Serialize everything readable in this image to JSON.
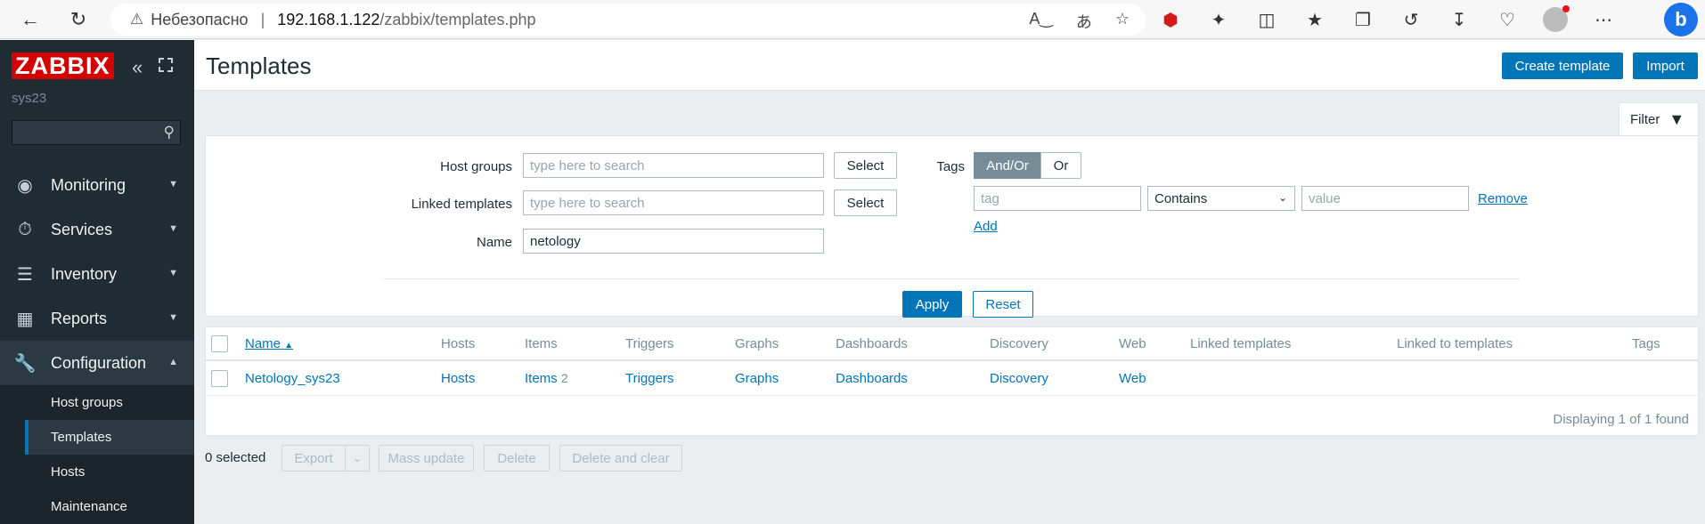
{
  "browser": {
    "insecure_label": "Небезопасно",
    "url_host": "192.168.1.122",
    "url_path": "/zabbix/templates.php"
  },
  "sidebar": {
    "logo": "ZABBIX",
    "server_name": "sys23",
    "menu": [
      {
        "label": "Monitoring",
        "icon": "eye-icon"
      },
      {
        "label": "Services",
        "icon": "stopwatch-icon"
      },
      {
        "label": "Inventory",
        "icon": "list-icon"
      },
      {
        "label": "Reports",
        "icon": "bar-chart-icon"
      },
      {
        "label": "Configuration",
        "icon": "wrench-icon"
      }
    ],
    "submenu": [
      "Host groups",
      "Templates",
      "Hosts",
      "Maintenance"
    ]
  },
  "header": {
    "title": "Templates",
    "create_label": "Create template",
    "import_label": "Import"
  },
  "filter": {
    "tab_label": "Filter",
    "host_groups_label": "Host groups",
    "linked_templates_label": "Linked templates",
    "name_label": "Name",
    "search_placeholder": "type here to search",
    "name_value": "netology",
    "select_label": "Select",
    "tags_label": "Tags",
    "and_or_label": "And/Or",
    "or_label": "Or",
    "tag_placeholder": "tag",
    "operator_value": "Contains",
    "value_placeholder": "value",
    "remove_label": "Remove",
    "add_label": "Add",
    "apply_label": "Apply",
    "reset_label": "Reset"
  },
  "table": {
    "columns": [
      "Name",
      "Hosts",
      "Items",
      "Triggers",
      "Graphs",
      "Dashboards",
      "Discovery",
      "Web",
      "Linked templates",
      "Linked to templates",
      "Tags"
    ],
    "rows": [
      {
        "name": "Netology_sys23",
        "hosts": "Hosts",
        "items": "Items",
        "items_count": "2",
        "triggers": "Triggers",
        "graphs": "Graphs",
        "dashboards": "Dashboards",
        "discovery": "Discovery",
        "web": "Web"
      }
    ],
    "paging": "Displaying 1 of 1 found"
  },
  "actions": {
    "selected": "0 selected",
    "export": "Export",
    "mass_update": "Mass update",
    "delete": "Delete",
    "delete_clear": "Delete and clear"
  }
}
